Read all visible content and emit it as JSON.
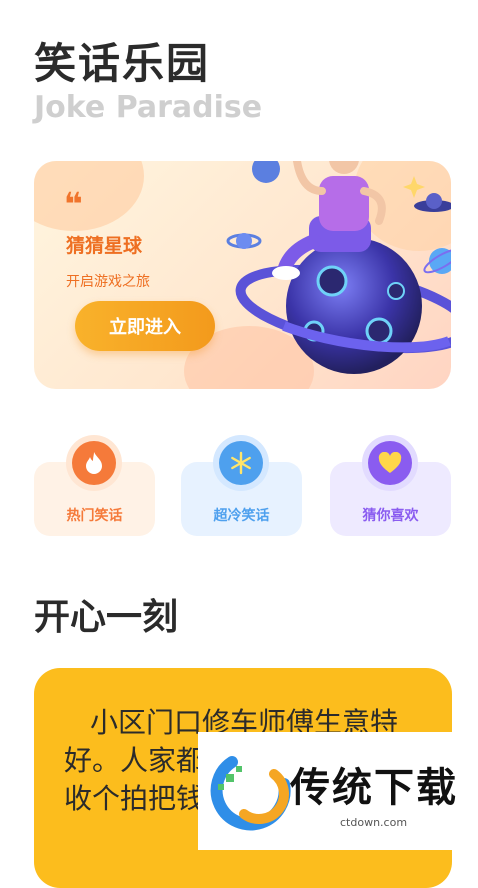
{
  "header": {
    "title": "笑话乐园",
    "subtitle": "Joke Paradise"
  },
  "banner": {
    "quote_mark": "❝",
    "title": "猜猜星球",
    "subtitle": "开启游戏之旅",
    "button_label": "立即进入"
  },
  "categories": [
    {
      "label": "热门笑话",
      "icon": "flame-icon",
      "color": "#f57a3a"
    },
    {
      "label": "超冷笑话",
      "icon": "snowflake-icon",
      "color": "#4ea0ee"
    },
    {
      "label": "猜你喜欢",
      "icon": "heart-icon",
      "color": "#8a5cf0"
    }
  ],
  "section": {
    "title": "开心一刻"
  },
  "joke": {
    "text": "小区门口修车师傅生意特好。人家都是修零件，常常收个拍把钱"
  },
  "watermark": {
    "name": "传统下载",
    "url": "ctdown.com"
  }
}
